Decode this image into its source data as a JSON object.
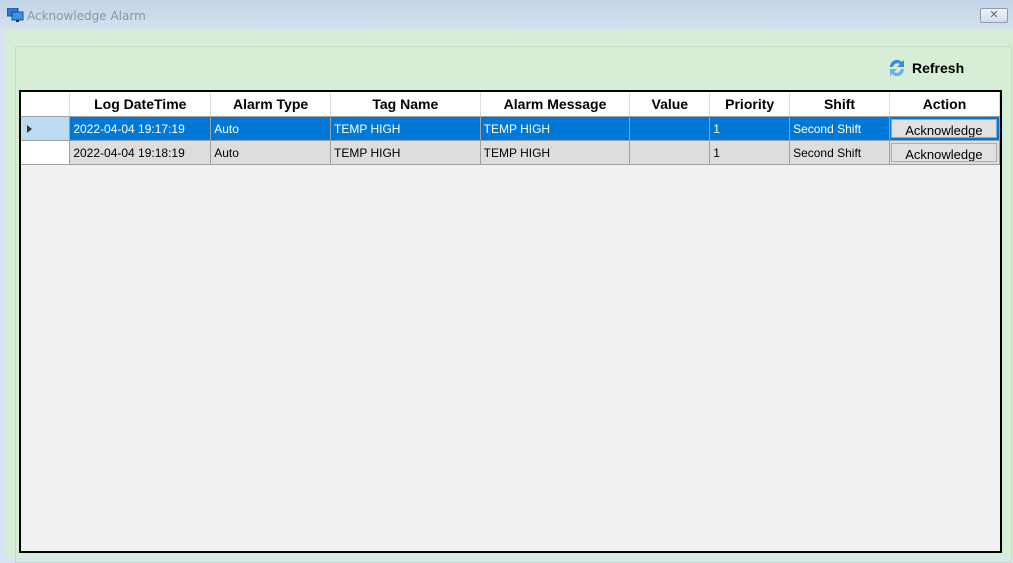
{
  "window": {
    "title": "Acknowledge Alarm",
    "close_label": "✕"
  },
  "toolbar": {
    "refresh_label": "Refresh",
    "refresh_icon": "refresh-icon"
  },
  "colors": {
    "selected_row": "#0078d7",
    "background": "#d5eed5"
  },
  "grid": {
    "columns": [
      "Log DateTime",
      "Alarm Type",
      "Tag Name",
      "Alarm Message",
      "Value",
      "Priority",
      "Shift",
      "Action"
    ],
    "rows": [
      {
        "log_datetime": "2022-04-04 19:17:19",
        "alarm_type": "Auto",
        "tag_name": "TEMP HIGH",
        "alarm_message": "TEMP HIGH",
        "value": "",
        "priority": "1",
        "shift": "Second Shift",
        "action": "Acknowledge",
        "selected": true
      },
      {
        "log_datetime": "2022-04-04 19:18:19",
        "alarm_type": "Auto",
        "tag_name": "TEMP HIGH",
        "alarm_message": "TEMP HIGH",
        "value": "",
        "priority": "1",
        "shift": "Second Shift",
        "action": "Acknowledge",
        "selected": false
      }
    ]
  }
}
